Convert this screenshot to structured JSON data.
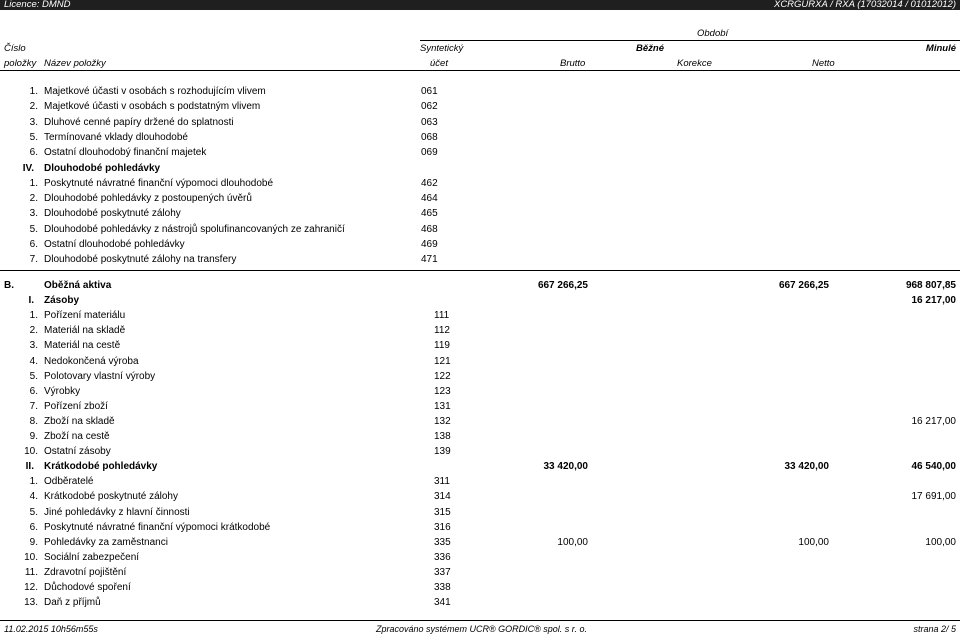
{
  "topbar": {
    "licence": "Licence: DMND",
    "code": "XCRGURXA / RXA   (17032014 / 01012012)"
  },
  "header": {
    "obdobi": "Období",
    "cislo": "Číslo",
    "polozky": "položky",
    "nazev": "Název položky",
    "syntet": "Syntetický",
    "ucet": "účet",
    "bezne": "Běžné",
    "minule": "Minulé",
    "brutto": "Brutto",
    "korekce": "Korekce",
    "netto": "Netto"
  },
  "rows": [
    {
      "no": "1.",
      "name": "Majetkové účasti v osobách s rozhodujícím vlivem",
      "acct": "061"
    },
    {
      "no": "2.",
      "name": "Majetkové účasti v osobách s podstatným vlivem",
      "acct": "062"
    },
    {
      "no": "3.",
      "name": "Dluhové cenné papíry držené do splatnosti",
      "acct": "063"
    },
    {
      "no": "5.",
      "name": "Termínované vklady dlouhodobé",
      "acct": "068"
    },
    {
      "no": "6.",
      "name": "Ostatní dlouhodobý finanční majetek",
      "acct": "069"
    },
    {
      "no": "IV.",
      "name": "Dlouhodobé pohledávky",
      "acct": "",
      "bold": true
    },
    {
      "no": "1.",
      "name": "Poskytnuté návratné finanční výpomoci dlouhodobé",
      "acct": "462"
    },
    {
      "no": "2.",
      "name": "Dlouhodobé pohledávky z postoupených úvěrů",
      "acct": "464"
    },
    {
      "no": "3.",
      "name": "Dlouhodobé poskytnuté zálohy",
      "acct": "465"
    },
    {
      "no": "5.",
      "name": "Dlouhodobé pohledávky z nástrojů spolufinancovaných ze zahraničí",
      "acct": "468"
    },
    {
      "no": "6.",
      "name": "Ostatní dlouhodobé pohledávky",
      "acct": "469"
    },
    {
      "no": "7.",
      "name": "Dlouhodobé poskytnuté zálohy na transfery",
      "acct": "471"
    }
  ],
  "rows2": [
    {
      "no": "B.",
      "name": "Oběžná aktiva",
      "acct": "",
      "v1": "667 266,25",
      "v2": "667 266,25",
      "v3": "968 807,85",
      "bold": true,
      "left": true
    },
    {
      "no": "I.",
      "name": "Zásoby",
      "acct": "",
      "v1": "",
      "v2": "",
      "v3": "16 217,00",
      "bold": true
    },
    {
      "no": "1.",
      "name": "Pořízení materiálu",
      "acct": "111",
      "v1": "",
      "v2": "",
      "v3": ""
    },
    {
      "no": "2.",
      "name": "Materiál na skladě",
      "acct": "112",
      "v1": "",
      "v2": "",
      "v3": ""
    },
    {
      "no": "3.",
      "name": "Materiál na cestě",
      "acct": "119",
      "v1": "",
      "v2": "",
      "v3": ""
    },
    {
      "no": "4.",
      "name": "Nedokončená výroba",
      "acct": "121",
      "v1": "",
      "v2": "",
      "v3": ""
    },
    {
      "no": "5.",
      "name": "Polotovary vlastní výroby",
      "acct": "122",
      "v1": "",
      "v2": "",
      "v3": ""
    },
    {
      "no": "6.",
      "name": "Výrobky",
      "acct": "123",
      "v1": "",
      "v2": "",
      "v3": ""
    },
    {
      "no": "7.",
      "name": "Pořízení zboží",
      "acct": "131",
      "v1": "",
      "v2": "",
      "v3": ""
    },
    {
      "no": "8.",
      "name": "Zboží na skladě",
      "acct": "132",
      "v1": "",
      "v2": "",
      "v3": "16 217,00"
    },
    {
      "no": "9.",
      "name": "Zboží na cestě",
      "acct": "138",
      "v1": "",
      "v2": "",
      "v3": ""
    },
    {
      "no": "10.",
      "name": "Ostatní zásoby",
      "acct": "139",
      "v1": "",
      "v2": "",
      "v3": ""
    },
    {
      "no": "II.",
      "name": "Krátkodobé pohledávky",
      "acct": "",
      "v1": "33 420,00",
      "v2": "33 420,00",
      "v3": "46 540,00",
      "bold": true
    },
    {
      "no": "1.",
      "name": "Odběratelé",
      "acct": "311",
      "v1": "",
      "v2": "",
      "v3": ""
    },
    {
      "no": "4.",
      "name": "Krátkodobé poskytnuté zálohy",
      "acct": "314",
      "v1": "",
      "v2": "",
      "v3": "17 691,00"
    },
    {
      "no": "5.",
      "name": "Jiné pohledávky z hlavní činnosti",
      "acct": "315",
      "v1": "",
      "v2": "",
      "v3": ""
    },
    {
      "no": "6.",
      "name": "Poskytnuté návratné finanční výpomoci krátkodobé",
      "acct": "316",
      "v1": "",
      "v2": "",
      "v3": ""
    },
    {
      "no": "9.",
      "name": "Pohledávky za zaměstnanci",
      "acct": "335",
      "v1": "100,00",
      "v2": "100,00",
      "v3": "100,00"
    },
    {
      "no": "10.",
      "name": "Sociální zabezpečení",
      "acct": "336",
      "v1": "",
      "v2": "",
      "v3": ""
    },
    {
      "no": "11.",
      "name": "Zdravotní pojištění",
      "acct": "337",
      "v1": "",
      "v2": "",
      "v3": ""
    },
    {
      "no": "12.",
      "name": "Důchodové spoření",
      "acct": "338",
      "v1": "",
      "v2": "",
      "v3": ""
    },
    {
      "no": "13.",
      "name": "Daň z příjmů",
      "acct": "341",
      "v1": "",
      "v2": "",
      "v3": ""
    }
  ],
  "footer": {
    "date": "11.02.2015 10h56m55s",
    "processed": "Zpracováno systémem  UCR® GORDIC® spol. s  r. o.",
    "page": "strana  2/ 5"
  }
}
